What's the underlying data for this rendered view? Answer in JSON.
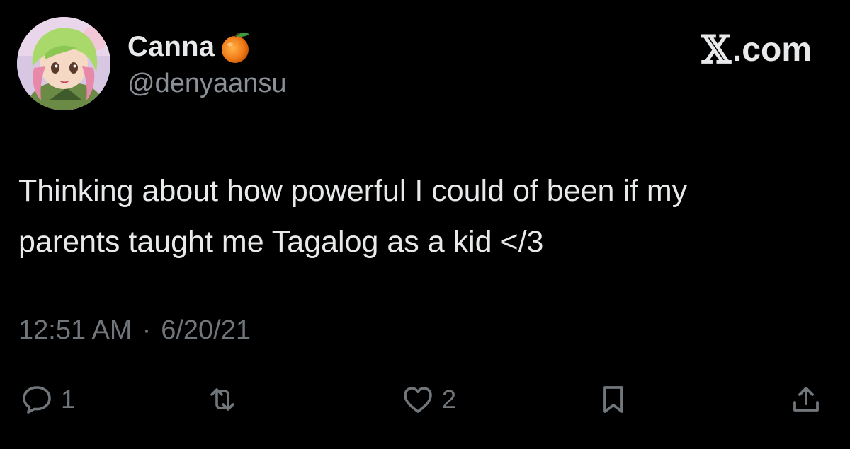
{
  "author": {
    "display_name": "Canna",
    "name_emoji": "orange-emoji",
    "handle": "@denyaansu",
    "avatar": "anime-avatar-green-pink-hair"
  },
  "brand": {
    "logo_mark": "𝕏",
    "logo_text": ".com"
  },
  "tweet": {
    "text": "Thinking about how powerful I could of been if my\nparents taught me Tagalog as a kid </3"
  },
  "meta": {
    "time": "12:51 AM",
    "separator": "·",
    "date": "6/20/21"
  },
  "actions": {
    "reply": {
      "icon": "reply-icon",
      "count": "1"
    },
    "retweet": {
      "icon": "retweet-icon",
      "count": ""
    },
    "like": {
      "icon": "heart-icon",
      "count": "2"
    },
    "bookmark": {
      "icon": "bookmark-icon",
      "count": ""
    },
    "share": {
      "icon": "share-icon",
      "count": ""
    }
  },
  "colors": {
    "background": "#000000",
    "primary_text": "#e7e9ea",
    "secondary_text": "#71767b"
  }
}
